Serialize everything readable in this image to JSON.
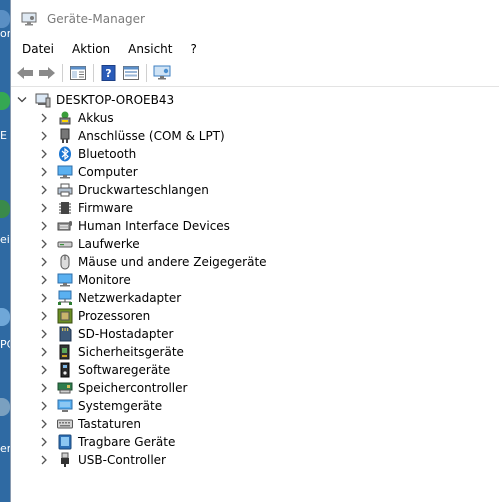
{
  "desktop": {
    "labels": [
      "or",
      "E",
      "ei",
      "PC",
      "erk"
    ]
  },
  "window": {
    "title": "Geräte-Manager"
  },
  "menu": [
    "Datei",
    "Aktion",
    "Ansicht",
    "?"
  ],
  "toolbar": [
    "back-icon",
    "forward-icon",
    "properties-icon",
    "help-icon",
    "update-driver-icon",
    "monitor-icon"
  ],
  "tree": {
    "root": {
      "label": "DESKTOP-OROEB43",
      "icon": "computer-icon",
      "expanded": true
    },
    "categories": [
      {
        "label": "Akkus",
        "icon": "battery-icon"
      },
      {
        "label": "Anschlüsse (COM & LPT)",
        "icon": "port-icon"
      },
      {
        "label": "Bluetooth",
        "icon": "bluetooth-icon"
      },
      {
        "label": "Computer",
        "icon": "computer-icon"
      },
      {
        "label": "Druckwarteschlangen",
        "icon": "printer-icon"
      },
      {
        "label": "Firmware",
        "icon": "chip-icon"
      },
      {
        "label": "Human Interface Devices",
        "icon": "hid-icon"
      },
      {
        "label": "Laufwerke",
        "icon": "drive-icon"
      },
      {
        "label": "Mäuse und andere Zeigegeräte",
        "icon": "mouse-icon"
      },
      {
        "label": "Monitore",
        "icon": "monitor-icon"
      },
      {
        "label": "Netzwerkadapter",
        "icon": "network-icon"
      },
      {
        "label": "Prozessoren",
        "icon": "cpu-icon"
      },
      {
        "label": "SD-Hostadapter",
        "icon": "sd-card-icon"
      },
      {
        "label": "Sicherheitsgeräte",
        "icon": "security-icon"
      },
      {
        "label": "Softwaregeräte",
        "icon": "software-device-icon"
      },
      {
        "label": "Speichercontroller",
        "icon": "storage-controller-icon"
      },
      {
        "label": "Systemgeräte",
        "icon": "system-icon"
      },
      {
        "label": "Tastaturen",
        "icon": "keyboard-icon"
      },
      {
        "label": "Tragbare Geräte",
        "icon": "portable-device-icon"
      },
      {
        "label": "USB-Controller",
        "icon": "usb-icon"
      }
    ]
  }
}
